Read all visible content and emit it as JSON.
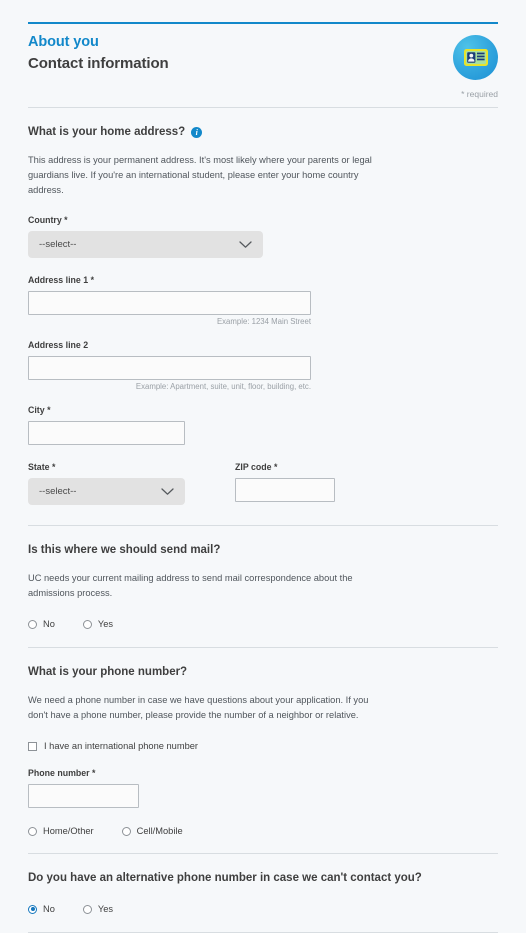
{
  "header": {
    "eyebrow": "About you",
    "title": "Contact information",
    "required_note": "* required",
    "badge_icon": "id-card-icon",
    "accent_color": "#1288ca",
    "title_color": "#3f3f3f"
  },
  "sections": {
    "home_address": {
      "question": "What is your home address?",
      "info_icon": "info-icon",
      "help_text": "This address is your permanent address. It's most likely where your parents or legal guardians live. If you're an international student, please enter your home country address.",
      "country": {
        "label": "Country *",
        "selected": "--select--"
      },
      "address_line_1": {
        "label": "Address line 1 *",
        "value": "",
        "hint": "Example: 1234 Main Street"
      },
      "address_line_2": {
        "label": "Address line 2",
        "value": "",
        "hint": "Example: Apartment, suite, unit, floor, building, etc."
      },
      "city": {
        "label": "City *",
        "value": ""
      },
      "state": {
        "label": "State *",
        "selected": "--select--"
      },
      "zip": {
        "label": "ZIP code *",
        "value": ""
      }
    },
    "mailing": {
      "question": "Is this where we should send mail?",
      "help_text": "UC needs your current mailing address to send mail correspondence about the admissions process.",
      "options": [
        {
          "label": "No",
          "selected": false
        },
        {
          "label": "Yes",
          "selected": false
        }
      ]
    },
    "phone": {
      "question": "What is your phone number?",
      "help_text": "We need a phone number in case we have questions about your application. If you don't have a phone number, please provide the number of a neighbor or relative.",
      "international_checkbox": {
        "label": "I have an international phone number",
        "checked": false
      },
      "phone_number": {
        "label": "Phone number *",
        "value": ""
      },
      "type_options": [
        {
          "label": "Home/Other",
          "selected": false
        },
        {
          "label": "Cell/Mobile",
          "selected": false
        }
      ]
    },
    "alternative_phone": {
      "question": "Do you have an alternative phone number in case we can't contact you?",
      "options": [
        {
          "label": "No",
          "selected": true
        },
        {
          "label": "Yes",
          "selected": false
        }
      ]
    }
  }
}
